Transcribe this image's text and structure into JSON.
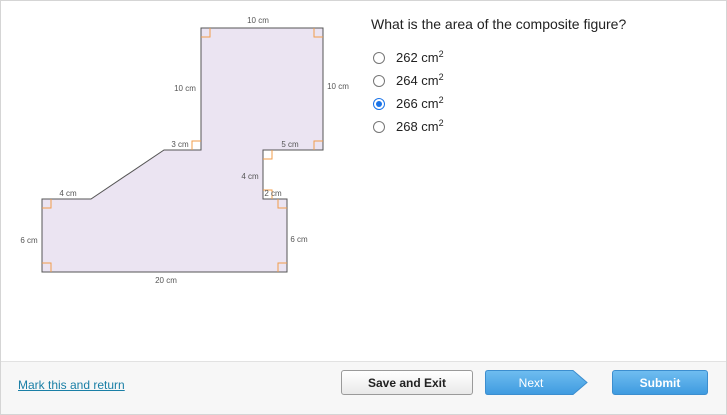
{
  "figure": {
    "fill_color": "#ebe4f2",
    "stroke_color": "#555555",
    "right_angle_color": "#f29d4b",
    "labels": {
      "top": "10 cm",
      "left_upper": "10 cm",
      "right_upper": "10 cm",
      "step_left": "3 cm",
      "step_right": "5 cm",
      "notch_vertical": "4 cm",
      "notch_horizontal": "2 cm",
      "lower_top_left": "4 cm",
      "left_lower": "6 cm",
      "right_lower": "6 cm",
      "bottom": "20 cm"
    }
  },
  "question": {
    "text": "What is the area of the composite figure?",
    "options": [
      {
        "value": "262 cm",
        "exp": "2",
        "selected": false
      },
      {
        "value": "264 cm",
        "exp": "2",
        "selected": false
      },
      {
        "value": "266 cm",
        "exp": "2",
        "selected": true
      },
      {
        "value": "268 cm",
        "exp": "2",
        "selected": false
      }
    ]
  },
  "footer": {
    "mark_return_label": "Mark this and return",
    "save_exit_label": "Save and Exit",
    "next_label": "Next",
    "submit_label": "Submit"
  },
  "colors": {
    "accent": "#1a73e8",
    "link": "#1a7fa6",
    "next_button": "#4aa3e6",
    "submit_button": "#4aa3e6"
  }
}
